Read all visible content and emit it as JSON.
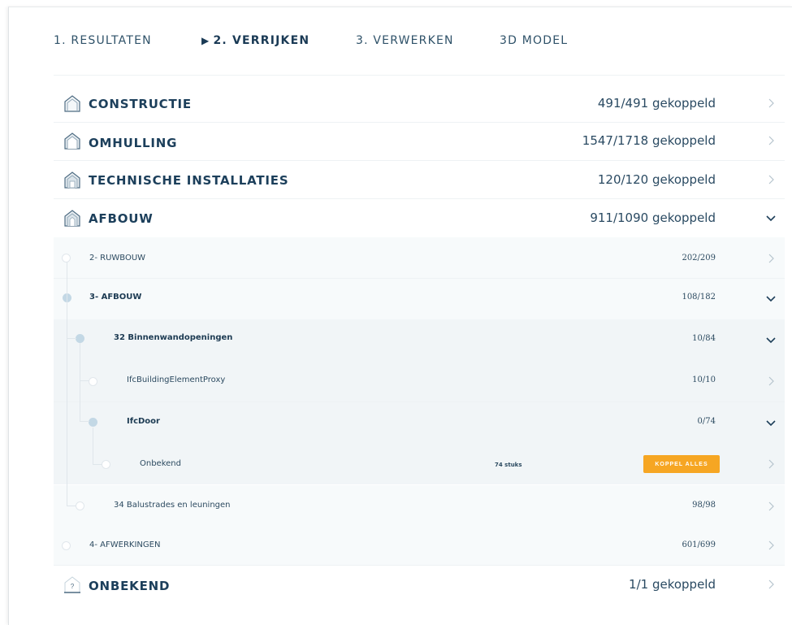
{
  "tabs": [
    {
      "label": "1. RESULTATEN",
      "active": false
    },
    {
      "label": "2. VERRIJKEN",
      "active": true,
      "marker": "▶"
    },
    {
      "label": "3. VERWERKEN",
      "active": false
    },
    {
      "label": "3D MODEL",
      "active": false
    }
  ],
  "categories": [
    {
      "name": "CONSTRUCTIE",
      "count": "491/491 gekoppeld",
      "icon": "building-outline-icon",
      "expanded": false
    },
    {
      "name": "OMHULLING",
      "count": "1547/1718 gekoppeld",
      "icon": "building-envelope-icon",
      "expanded": false
    },
    {
      "name": "TECHNISCHE INSTALLATIES",
      "count": "120/120 gekoppeld",
      "icon": "building-installations-icon",
      "expanded": false
    },
    {
      "name": "AFBOUW",
      "count": "911/1090 gekoppeld",
      "icon": "building-finishing-icon",
      "expanded": true
    },
    {
      "name": "ONBEKEND",
      "count": "1/1 gekoppeld",
      "icon": "unknown-building-icon",
      "icon_glyph": "?",
      "expanded": false
    }
  ],
  "subrows": [
    {
      "label": "2- RUWBOUW",
      "count": "202/209",
      "expanded": false
    },
    {
      "label": "3- AFBOUW",
      "count": "108/182",
      "expanded": true
    },
    {
      "label": "32 Binnenwandopeningen",
      "count": "10/84",
      "expanded": true
    },
    {
      "label": "IfcBuildingElementProxy",
      "count": "10/10",
      "expanded": false
    },
    {
      "label": "IfcDoor",
      "count": "0/74",
      "expanded": true
    },
    {
      "label": "Onbekend",
      "pieces": "74 stuks",
      "button": "KOPPEL ALLES"
    },
    {
      "label": "34 Balustrades en leuningen",
      "count": "98/98",
      "expanded": false
    },
    {
      "label": "4- AFWERKINGEN",
      "count": "601/699",
      "expanded": false
    }
  ],
  "colors": {
    "accent": "#f6a623",
    "text": "#1e3f5a",
    "node": "#c3d8e5"
  }
}
